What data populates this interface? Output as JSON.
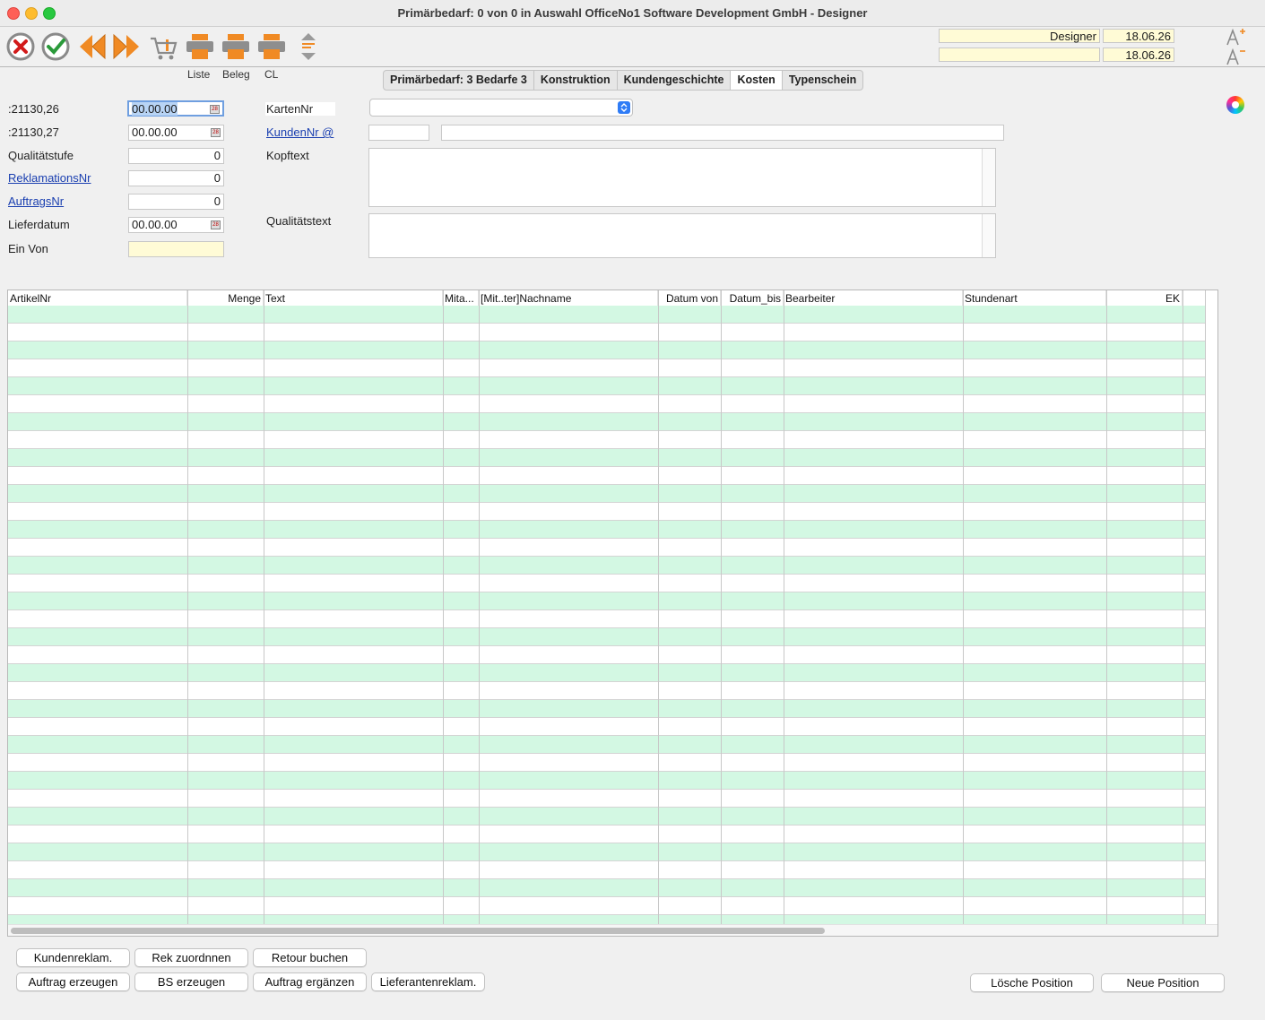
{
  "window": {
    "title": "Primärbedarf: 0 von 0 in Auswahl OfficeNo1 Software Development GmbH - Designer"
  },
  "toolbar": {
    "labels": {
      "liste": "Liste",
      "beleg": "Beleg",
      "cl": "CL"
    },
    "user_field": "Designer",
    "date1": "18.06.26",
    "date2": "18.06.26",
    "empty_field": ""
  },
  "tabs": [
    "Primärbedarf: 3 Bedarfe 3",
    "Konstruktion",
    "Kundengeschichte",
    "Kosten",
    "Typenschein"
  ],
  "form": {
    "date_field1_label": ":21130,26",
    "date_field1_value": "00.00.00",
    "date_field2_label": ":21130,27",
    "date_field2_value": "00.00.00",
    "qualitaetsstufe_label": "Qualitätstufe",
    "qualitaetsstufe_value": "0",
    "reklamationsnr_label": "ReklamationsNr",
    "reklamationsnr_value": "0",
    "auftragsnr_label": "AuftragsNr",
    "auftragsnr_value": "0",
    "lieferdatum_label": "Lieferdatum",
    "lieferdatum_value": "00.00.00",
    "ein_von_label": "Ein Von",
    "ein_von_value": "",
    "kartennr_label": "KartenNr",
    "kartennr_value": "",
    "kundennr_label": "KundenNr @",
    "kundennr_value": "",
    "kundenname_value": "",
    "kopftext_label": "Kopftext",
    "qualitaetstext_label": "Qualitätstext"
  },
  "table": {
    "columns": [
      "ArtikelNr",
      "Menge",
      "Text",
      "Mita...",
      "[Mit..ter]Nachname",
      "Datum von",
      "Datum_bis",
      "Bearbeiter",
      "Stundenart",
      "EK"
    ],
    "row_count": 35
  },
  "buttons": {
    "kundenreklam": "Kundenreklam.",
    "rek_zuordnen": "Rek zuordnnen",
    "retour_buchen": "Retour buchen",
    "auftrag_erzeugen": "Auftrag erzeugen",
    "bs_erzeugen": "BS erzeugen",
    "auftrag_ergaenzen": "Auftrag ergänzen",
    "lieferantenreklam": "Lieferantenreklam.",
    "loesche_position": "Lösche Position",
    "neue_position": "Neue Position"
  },
  "colors": {
    "row_alt": "#d3f8e3",
    "input_yellow": "#fffbd6",
    "link": "#1a3fb0",
    "accent_orange": "#f08a24"
  }
}
